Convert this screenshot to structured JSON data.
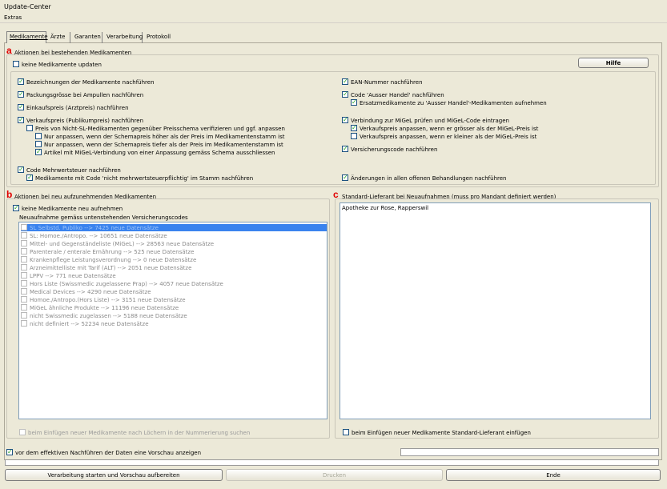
{
  "window": {
    "title": "Update-Center"
  },
  "menu": {
    "extras": "Extras"
  },
  "tabs": [
    {
      "label": "Medikamente"
    },
    {
      "label": "Ärzte"
    },
    {
      "label": "Garanten"
    },
    {
      "label": "Verarbeitung"
    },
    {
      "label": "Protokoll"
    }
  ],
  "section_a": {
    "letter": "a",
    "title": "Aktionen bei bestehenden Medikamenten",
    "no_update": "keine Medikamente updaten",
    "help_button": "Hilfe",
    "left": [
      "Bezeichnungen der Medikamente nachführen",
      "Packungsgrösse bei Ampullen nachführen",
      "Einkaufspreis (Arztpreis) nachführen",
      "Verkaufspreis (Publikumpreis) nachführen",
      "Preis von Nicht-SL-Medikamenten gegenüber Preisschema verifizieren und ggf. anpassen",
      "Nur anpassen, wenn der Schemapreis höher als der Preis im Medikamentenstamm ist",
      "Nur anpassen, wenn der Schemapreis tiefer als der Preis im Medikamentenstamm ist",
      "Artikel mit MiGeL-Verbindung von einer Anpassung gemäss Schema ausschliessen",
      "Code Mehrwertsteuer nachführen",
      "Medikamente mit Code 'nicht mehrwertsteuerpflichtig' im Stamm nachführen"
    ],
    "right": [
      "EAN-Nummer nachführen",
      "Code 'Ausser Handel' nachführen",
      "Ersatzmedikamente zu 'Ausser Handel'-Medikamenten aufnehmen",
      "Verbindung zur MiGeL prüfen und MiGeL-Code eintragen",
      "Verkaufspreis anpassen, wenn er grösser als der MiGeL-Preis ist",
      "Verkaufspreis anpassen, wenn er kleiner als der MiGeL-Preis ist",
      "Versicherungscode nachführen",
      "Änderungen in allen offenen Behandlungen nachführen"
    ]
  },
  "section_b": {
    "letter": "b",
    "title": "Aktionen bei neu aufzunehmenden Medikamenten",
    "no_new": "keine Medikamente neu aufnehmen",
    "list_title": "Neuaufnahme gemäss untenstehenden Versicherungscodes",
    "list": [
      "SL Selbstd. Publiko   --> 7425 neue Datensätze",
      "SL: Homoe./Antropo.   --> 10651 neue Datensätze",
      "Mittel- und Gegenständeliste (MiGeL)   --> 28563 neue Datensätze",
      "Parenterale / enterale Ernährung   --> 525 neue Datensätze",
      "Krankenpflege Leistungsverordnung   --> 0 neue Datensätze",
      "Arzneimittelliste mit Tarif (ALT)   --> 2051 neue Datensätze",
      "LPPV   --> 771 neue Datensätze",
      "Hors Liste (Swissmedic zugelassene Prap)   --> 4057 neue Datensätze",
      "Medical Devices   --> 4290 neue Datensätze",
      "Homoe./Antropo.(Hors Liste)   --> 3151 neue Datensätze",
      "MiGeL ähnliche Produkte   --> 11196 neue Datensätze",
      "nicht Swissmedic zugelassen   --> 5188 neue Datensätze",
      "nicht definiert   --> 52234 neue Datensätze"
    ],
    "gaps": "beim Einfügen neuer Medikamente nach Löchern in der Nummerierung suchen"
  },
  "section_c": {
    "letter": "c",
    "title": "Standard-Lieferant bei Neuaufnahmen (muss pro Mandant definiert werden)",
    "value": "Apotheke zur Rose, Rapperswil",
    "insert": "beim Einfügen neuer Medikamente Standard-Lieferant einfügen"
  },
  "footer": {
    "preview": "vor dem effektiven Nachführen der Daten eine Vorschau anzeigen",
    "start_button": "Verarbeitung starten und Vorschau aufbereiten",
    "print_button": "Drucken",
    "end_button": "Ende"
  }
}
